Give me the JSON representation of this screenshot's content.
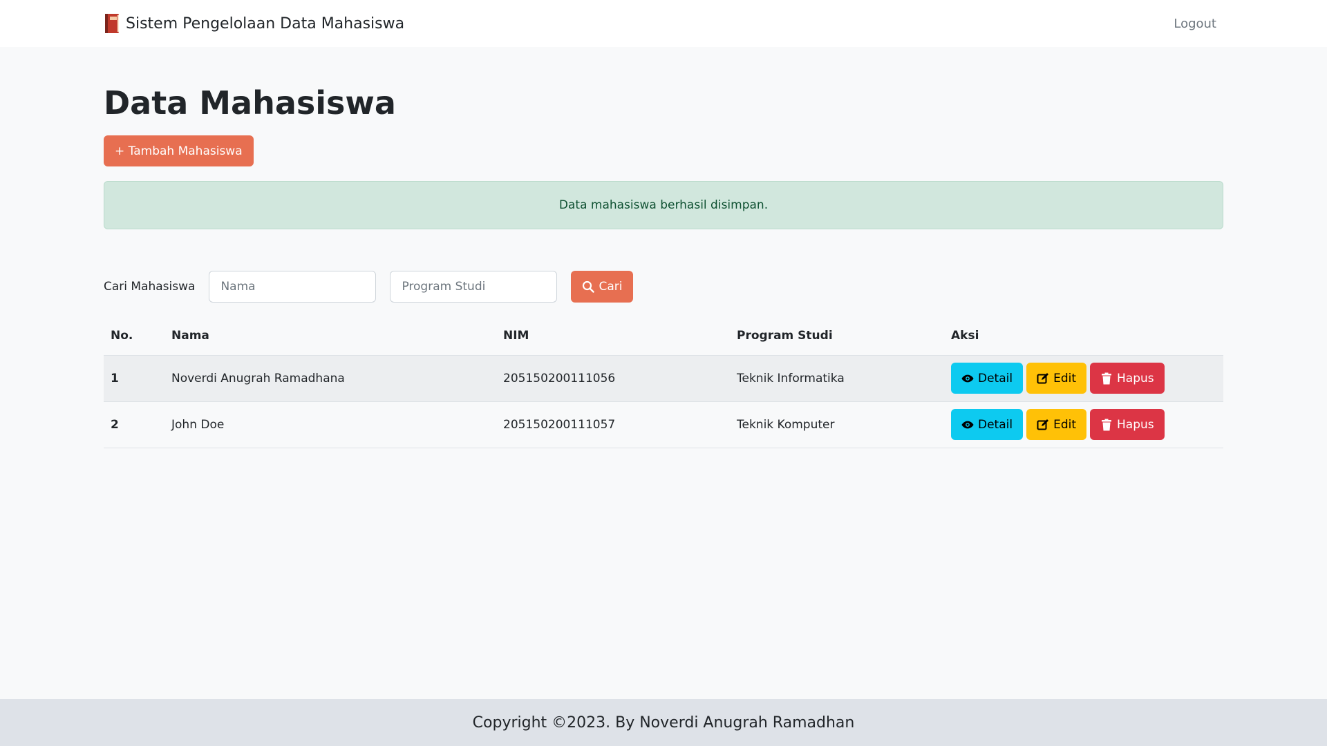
{
  "navbar": {
    "brand_icon": "book-icon",
    "brand": "Sistem Pengelolaan Data Mahasiswa",
    "logout_label": "Logout"
  },
  "page": {
    "title": "Data Mahasiswa",
    "add_button_label": "+ Tambah Mahasiswa"
  },
  "alert": {
    "message": "Data mahasiswa berhasil disimpan.",
    "color": "#d1e7dd"
  },
  "search": {
    "label": "Cari Mahasiswa",
    "name_placeholder": "Nama",
    "name_value": "",
    "prodi_placeholder": "Program Studi",
    "prodi_value": "",
    "button_label": "Cari",
    "button_icon": "search-icon"
  },
  "table": {
    "headers": [
      "No.",
      "Nama",
      "NIM",
      "Program Studi",
      "Aksi"
    ],
    "rows": [
      {
        "no": "1",
        "nama": "Noverdi Anugrah Ramadhana",
        "nim": "205150200111056",
        "prodi": "Teknik Informatika"
      },
      {
        "no": "2",
        "nama": "John Doe",
        "nim": "205150200111057",
        "prodi": "Teknik Komputer"
      }
    ],
    "actions": {
      "detail_label": "Detail",
      "edit_label": "Edit",
      "delete_label": "Hapus"
    }
  },
  "colors": {
    "accent": "#e76f51",
    "detail": "#0dcaf0",
    "edit": "#ffc107",
    "delete": "#dc3545"
  },
  "footer": {
    "text": "Copyright ©2023. By Noverdi Anugrah Ramadhan"
  }
}
